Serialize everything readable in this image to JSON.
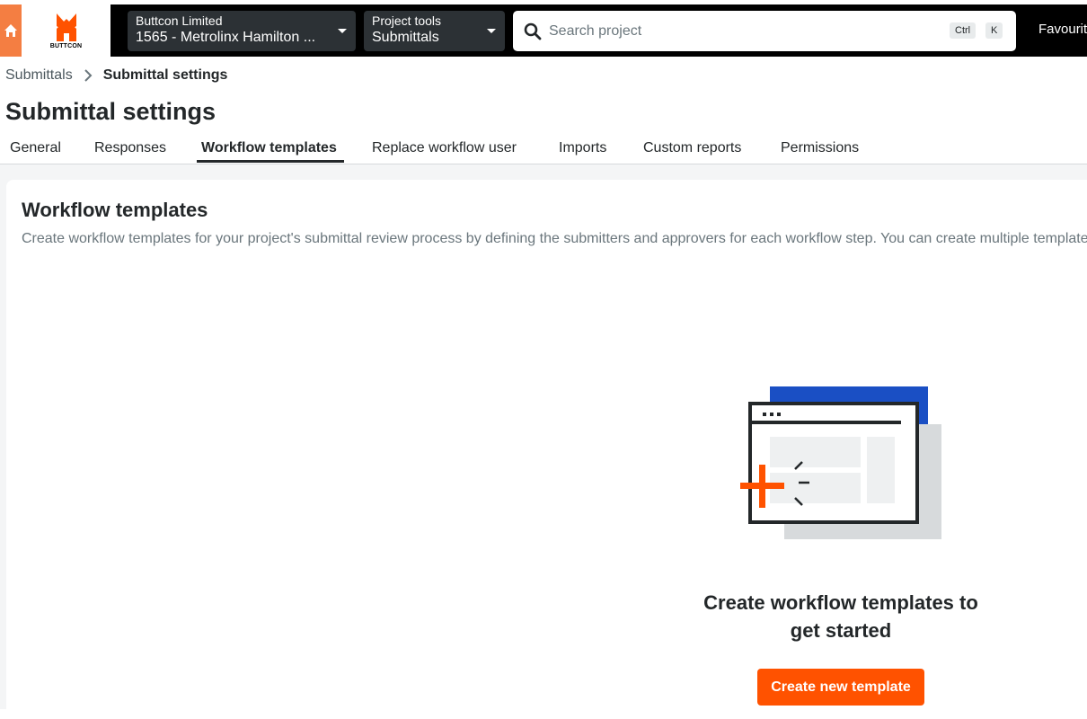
{
  "topnav": {
    "logo_text": "BUTTCON",
    "company": {
      "label": "Buttcon Limited",
      "value": "1565 - Metrolinx Hamilton ..."
    },
    "tools": {
      "label": "Project tools",
      "value": "Submittals"
    },
    "search": {
      "placeholder": "Search project",
      "shortcut_ctrl": "Ctrl",
      "shortcut_key": "K"
    },
    "favourites_label": "Favourites",
    "colors": {
      "bar": "#000000",
      "home": "#f47e42",
      "logo_accent": "#ff5200"
    }
  },
  "breadcrumb": {
    "parent": "Submittals",
    "current": "Submittal settings"
  },
  "page_title": "Submittal settings",
  "tabs": [
    {
      "label": "General"
    },
    {
      "label": "Responses"
    },
    {
      "label": "Workflow templates",
      "active": true
    },
    {
      "label": "Replace workflow user"
    },
    {
      "label": "Imports"
    },
    {
      "label": "Custom reports"
    },
    {
      "label": "Permissions"
    }
  ],
  "card": {
    "title": "Workflow templates",
    "description": "Create workflow templates for your project's submittal review process by defining the submitters and approvers for each workflow step. You can create multiple templates."
  },
  "empty_state": {
    "title": "Create workflow templates to get started",
    "button_label": "Create new template",
    "button_color": "#ff5200",
    "illustration_accent": "#1a4fc4"
  }
}
